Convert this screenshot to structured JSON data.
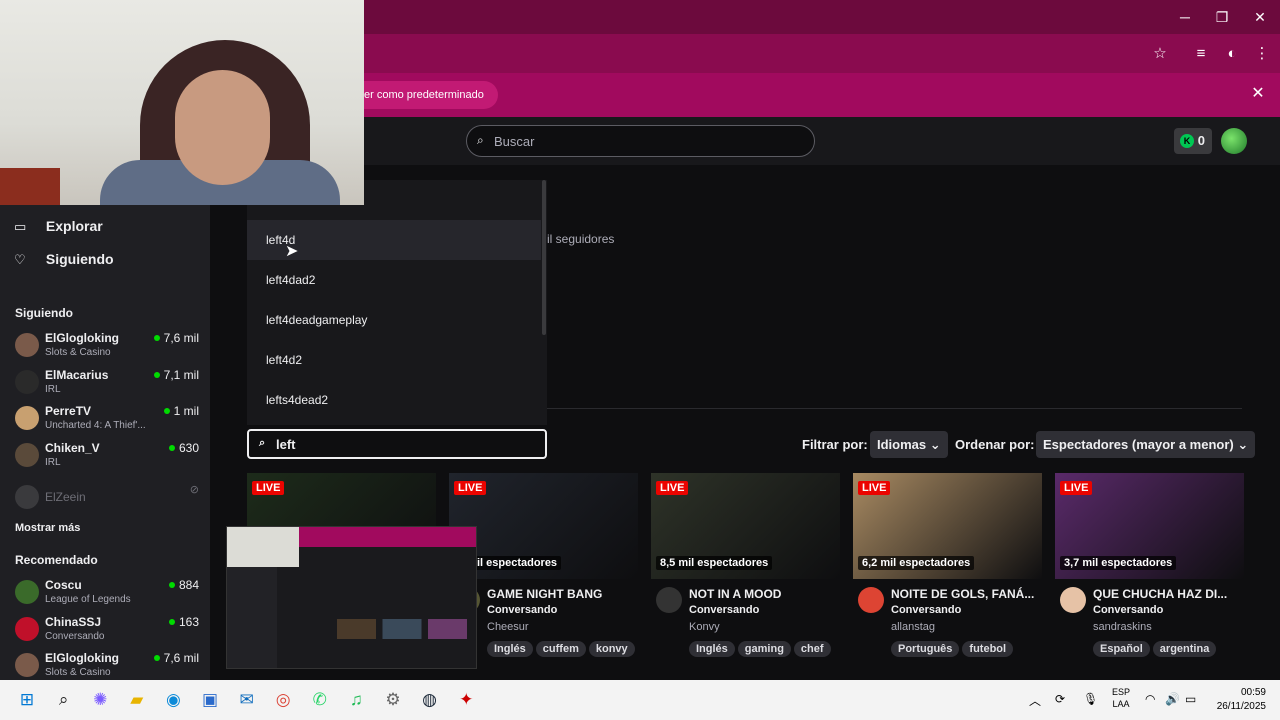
{
  "browser": {
    "infobar_text": "er como predeterminado",
    "window_controls": [
      "minimize-icon",
      "restore-icon",
      "close-icon"
    ],
    "toolbar_icons": [
      "star-icon",
      "media-icon",
      "profile-icon",
      "menu-icon"
    ]
  },
  "header": {
    "search_placeholder": "Buscar",
    "points": "0"
  },
  "sidebar": {
    "nav": [
      {
        "label": "Explorar",
        "icon": "browse-icon"
      },
      {
        "label": "Siguiendo",
        "icon": "heart-icon"
      }
    ],
    "following_title": "Siguiendo",
    "following": [
      {
        "name": "ElGlogloking",
        "game": "Slots & Casino",
        "viewers": "7,6 mil",
        "color": "#7a5a4a"
      },
      {
        "name": "ElMacarius",
        "game": "IRL",
        "viewers": "7,1 mil",
        "color": "#2a2a2a"
      },
      {
        "name": "PerreTV",
        "game": "Uncharted 4: A Thief'...",
        "viewers": "1 mil",
        "color": "#c8a070"
      },
      {
        "name": "Chiken_V",
        "game": "IRL",
        "viewers": "630",
        "color": "#5a4a3a"
      }
    ],
    "offline": {
      "name": "ElZeein"
    },
    "show_more": "Mostrar más",
    "recommended_title": "Recomendado",
    "recommended": [
      {
        "name": "Coscu",
        "game": "League of Legends",
        "viewers": "884",
        "color": "#3a6a2a"
      },
      {
        "name": "ChinaSSJ",
        "game": "Conversando",
        "viewers": "163",
        "color": "#c0102a"
      },
      {
        "name": "ElGlogloking",
        "game": "Slots & Casino",
        "viewers": "7,6 mil",
        "color": "#7a5a4a"
      }
    ]
  },
  "dropdown": {
    "items": [
      "left4d",
      "left4dad2",
      "left4deadgameplay",
      "left4d2",
      "lefts4dead2"
    ]
  },
  "background": {
    "followers_fragment": "il seguidores"
  },
  "filters": {
    "input_value": "left",
    "filter_label": "Filtrar por:",
    "language_btn": "Idiomas",
    "sort_label": "Ordenar por:",
    "sort_btn": "Espectadores (mayor a menor)"
  },
  "cards": [
    {
      "live": "LIVE",
      "views": "",
      "title": "",
      "category": "",
      "channel": "",
      "tags": [],
      "thumb": "#1d2b1a",
      "avatar": "#444"
    },
    {
      "live": "LIVE",
      "views": "3 mil espectadores",
      "title": "GAME NIGHT BANG",
      "category": "Conversando",
      "channel": "Cheesur",
      "tags": [
        "Inglés",
        "cuffem",
        "konvy"
      ],
      "thumb": "#20242c",
      "avatar": "#553"
    },
    {
      "live": "LIVE",
      "views": "8,5 mil espectadores",
      "title": "NOT IN A MOOD",
      "category": "Conversando",
      "channel": "Konvy",
      "tags": [
        "Inglés",
        "gaming",
        "chef"
      ],
      "thumb": "#2e3328",
      "avatar": "#333"
    },
    {
      "live": "LIVE",
      "views": "6,2 mil espectadores",
      "title": "NOITE DE GOLS, FANÁ...",
      "category": "Conversando",
      "channel": "allanstag",
      "tags": [
        "Português",
        "futebol"
      ],
      "thumb": "#a88a62",
      "avatar": "#d43"
    },
    {
      "live": "LIVE",
      "views": "3,7 mil espectadores",
      "title": "QUE CHUCHA HAZ DI...",
      "category": "Conversando",
      "channel": "sandraskins",
      "tags": [
        "Español",
        "argentina"
      ],
      "thumb": "#5a2a6a",
      "avatar": "#e6c2a6"
    }
  ],
  "taskbar": {
    "icons": [
      "windows-icon",
      "search-icon",
      "copilot-icon",
      "folder-icon",
      "edge-icon",
      "store-icon",
      "outlook-icon",
      "chrome-icon",
      "whatsapp-icon",
      "spotify-icon",
      "settings-icon",
      "steam-icon",
      "app-icon"
    ],
    "lang_line1": "ESP",
    "lang_line2": "LAA",
    "time": "00:59",
    "date": "26/11/2025"
  }
}
